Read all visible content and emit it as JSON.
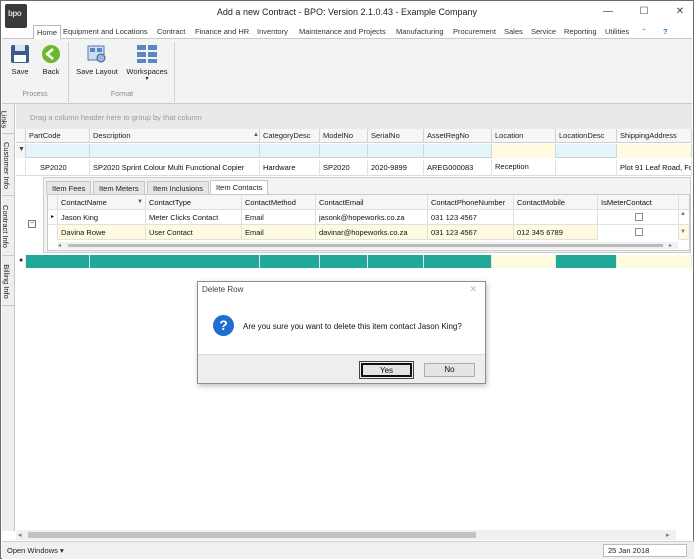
{
  "window": {
    "title": "Add a new Contract - BPO: Version 2.1.0.43 - Example Company",
    "logo_text": "bpo",
    "minimize": "—",
    "maximize": "☐",
    "close": "✕"
  },
  "menu": {
    "tabs": [
      "Home",
      "Equipment and Locations",
      "Contract",
      "Finance and HR",
      "Inventory",
      "Maintenance and Projects",
      "Manufacturing",
      "Procurement",
      "Sales",
      "Service",
      "Reporting",
      "Utilities"
    ]
  },
  "ribbon": {
    "process": {
      "label": "Process",
      "save": "Save",
      "back": "Back"
    },
    "format": {
      "label": "Format",
      "save_layout": "Save Layout",
      "workspaces": "Workspaces"
    }
  },
  "side_tabs": [
    "Links",
    "Customer Info",
    "Contract Info",
    "Billing Info"
  ],
  "grid": {
    "group_hint": "Drag a column header here to group by that column",
    "columns": [
      "PartCode",
      "Description",
      "CategoryDesc",
      "ModelNo",
      "SerialNo",
      "AssetRegNo",
      "Location",
      "LocationDesc",
      "ShippingAddress"
    ],
    "rows": [
      {
        "PartCode": "SP2020",
        "Description": "SP2020 Sprint Colour Multi Functional Copier",
        "CategoryDesc": "Hardware",
        "ModelNo": "SP2020",
        "SerialNo": "2020-9899",
        "AssetRegNo": "AREG000083",
        "Location": "Reception",
        "LocationDesc": "",
        "ShippingAddress": "Plot 91 Leaf Road, Fo"
      }
    ]
  },
  "detail": {
    "tabs": [
      "Item Fees",
      "Item Meters",
      "Item Inclusions",
      "Item Contacts"
    ],
    "active_tab": "Item Contacts",
    "columns": [
      "ContactName",
      "ContactType",
      "ContactMethod",
      "ContactEmail",
      "ContactPhoneNumber",
      "ContactMobile",
      "IsMeterContact"
    ],
    "rows": [
      {
        "ContactName": "Jason King",
        "ContactType": "Meter Clicks Contact",
        "ContactMethod": "Email",
        "ContactEmail": "jasonk@hopeworks.co.za",
        "ContactPhoneNumber": "031 123 4567",
        "ContactMobile": "",
        "IsMeterContact": false
      },
      {
        "ContactName": "Davina Rowe",
        "ContactType": "User Contact",
        "ContactMethod": "Email",
        "ContactEmail": "davinar@hopeworks.co.za",
        "ContactPhoneNumber": "031 123 4567",
        "ContactMobile": "012 345 6789",
        "IsMeterContact": false
      }
    ]
  },
  "dialog": {
    "title": "Delete Row",
    "close": "✕",
    "message": "Are you sure you want to delete this item contact Jason King?",
    "icon": "?",
    "yes": "Yes",
    "no": "No"
  },
  "status": {
    "open_windows": "Open Windows ▾",
    "date": "25 Jan 2018"
  },
  "colors": {
    "accent_teal": "#20a898",
    "filter_row": "#e4f4fb",
    "dialog_icon": "#1f6fd1"
  }
}
